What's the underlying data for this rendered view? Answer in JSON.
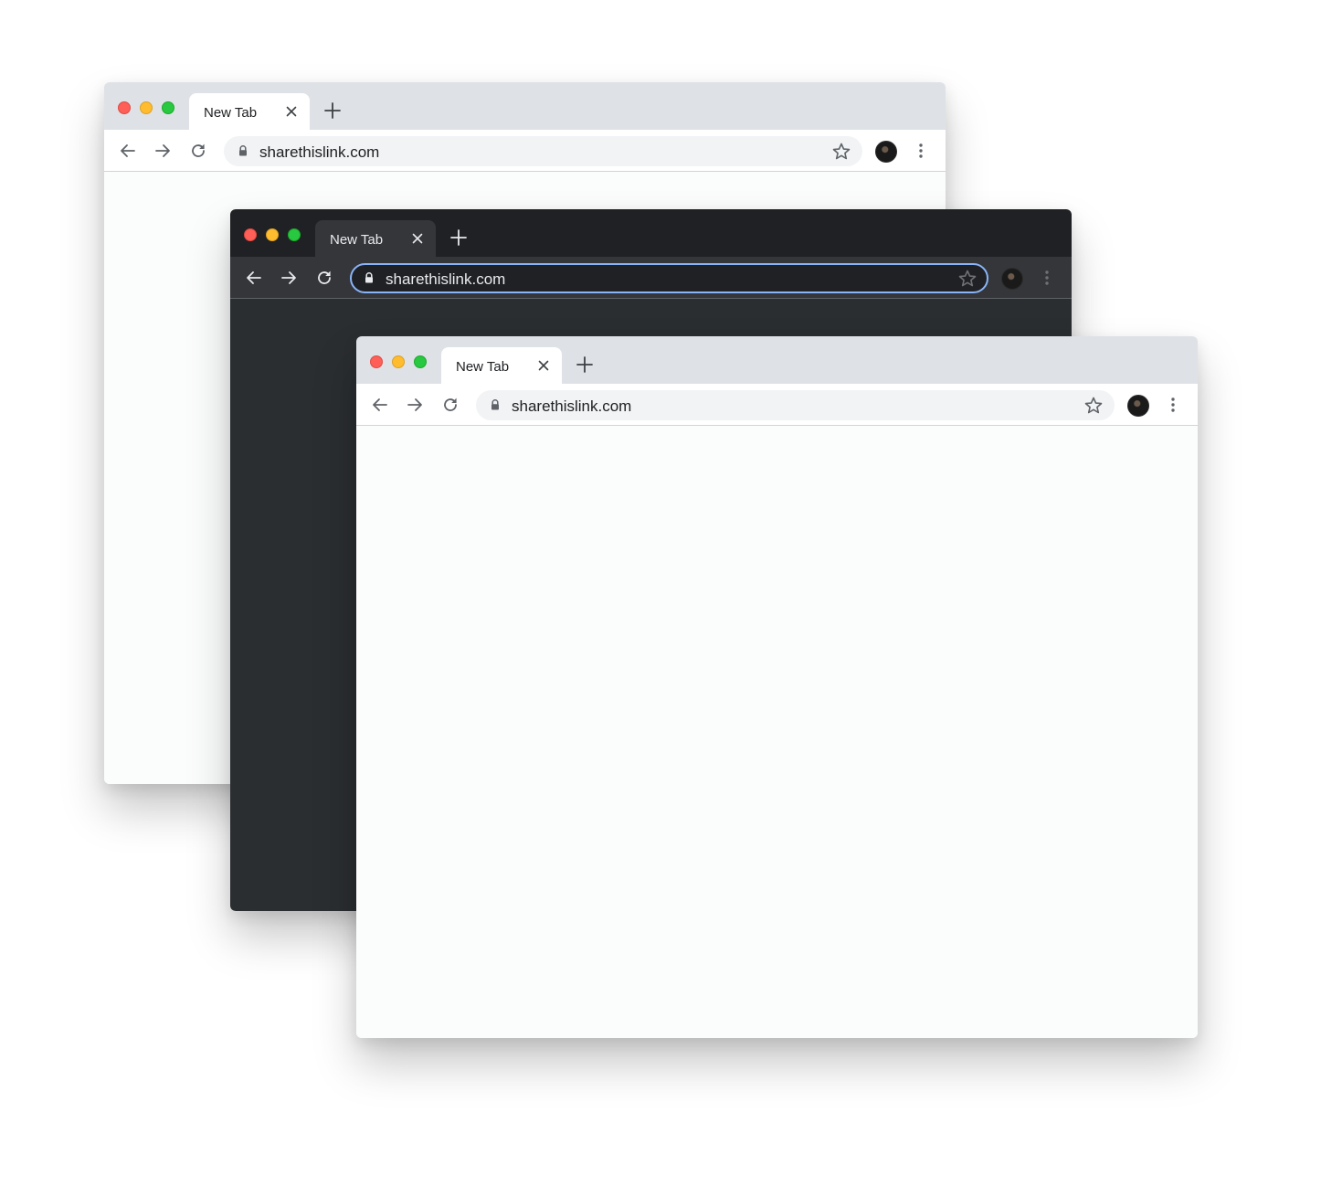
{
  "colors": {
    "light_titlebar": "#dee1e6",
    "dark_titlebar": "#202124",
    "dark_content": "#2b2e31",
    "dark_focus_ring": "#8ab4f8",
    "traffic_red": "#fe5f57",
    "traffic_yellow": "#febc2e",
    "traffic_green": "#28c840"
  },
  "windows": {
    "back": {
      "theme": "light",
      "tab_title": "New Tab",
      "url": "sharethislink.com"
    },
    "middle": {
      "theme": "dark",
      "tab_title": "New Tab",
      "url": "sharethislink.com"
    },
    "front": {
      "theme": "light",
      "tab_title": "New Tab",
      "url": "sharethislink.com"
    }
  },
  "icons": {
    "close_tab": "close-icon",
    "new_tab": "plus-icon",
    "back": "arrow-left-icon",
    "forward": "arrow-right-icon",
    "reload": "reload-icon",
    "secure": "lock-icon",
    "bookmark": "star-icon",
    "profile": "avatar",
    "menu": "kebab-menu-icon"
  }
}
